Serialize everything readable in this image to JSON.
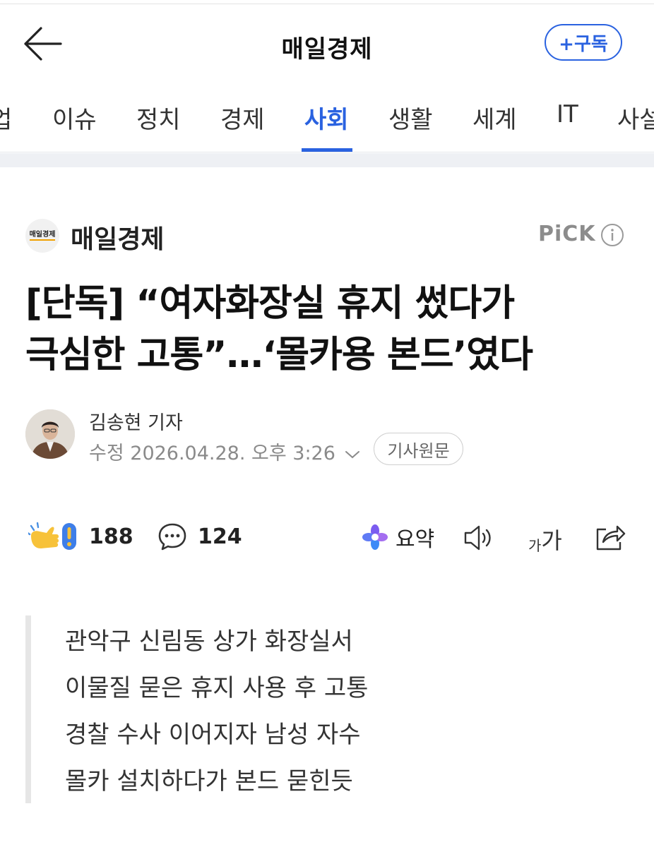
{
  "header": {
    "title": "매일경제",
    "subscribe_label": "+구독"
  },
  "tabs": [
    {
      "label": "업"
    },
    {
      "label": "이슈"
    },
    {
      "label": "정치"
    },
    {
      "label": "경제"
    },
    {
      "label": "사회",
      "active": true
    },
    {
      "label": "생활"
    },
    {
      "label": "세계"
    },
    {
      "label": "IT"
    },
    {
      "label": "사설"
    }
  ],
  "press": {
    "logo_text": "매일경제",
    "name": "매일경제",
    "pick_label": "PiCK"
  },
  "article": {
    "headline_lines": [
      "[단독] “여자화장실 휴지 썼다가",
      "극심한 고통”…‘몰카용 본드’였다"
    ],
    "reporter": "김송현 기자",
    "updated": "수정 2026.04.28. 오후 3:26",
    "original_label": "기사원문"
  },
  "actions": {
    "reaction_count": "188",
    "comment_count": "124",
    "summary_label": "요약",
    "font_small": "가",
    "font_big": "가"
  },
  "summary_lines": [
    "관악구 신림동 상가 화장실서",
    "이물질 묻은 휴지 사용 후 고통",
    "경찰 수사 이어지자 남성 자수",
    "몰카 설치하다가 본드 묻힌듯"
  ],
  "colors": {
    "accent": "#2a62e0",
    "muted": "#8a8a8a"
  },
  "icons": [
    "back-arrow-icon",
    "info-icon",
    "chevron-down-icon",
    "reaction-icon",
    "comment-icon",
    "ai-summary-icon",
    "speaker-icon",
    "share-icon"
  ]
}
